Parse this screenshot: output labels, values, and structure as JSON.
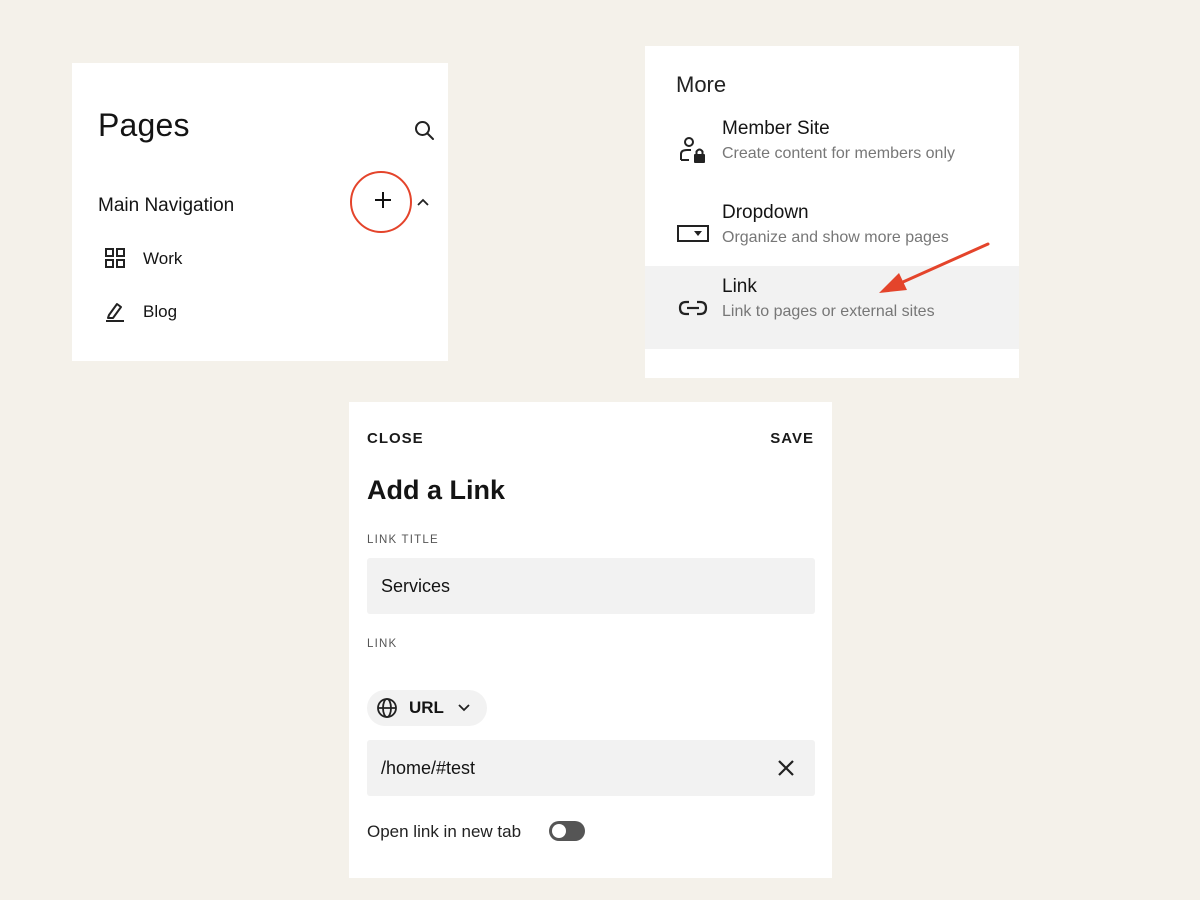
{
  "pages_panel": {
    "title": "Pages",
    "section_label": "Main Navigation",
    "items": [
      {
        "label": "Work",
        "icon": "grid-icon"
      },
      {
        "label": "Blog",
        "icon": "blog-edit-icon"
      }
    ]
  },
  "more_panel": {
    "title": "More",
    "items": [
      {
        "title": "Member Site",
        "desc": "Create content for members only",
        "icon": "member-lock-icon"
      },
      {
        "title": "Dropdown",
        "desc": "Organize and show more pages",
        "icon": "dropdown-icon"
      },
      {
        "title": "Link",
        "desc": "Link to pages or external sites",
        "icon": "link-icon"
      }
    ],
    "selected_index": 2
  },
  "link_panel": {
    "close_label": "CLOSE",
    "save_label": "SAVE",
    "title": "Add a Link",
    "link_title_label": "LINK TITLE",
    "link_title_value": "Services",
    "link_label": "LINK",
    "link_type": "URL",
    "url_value": "/home/#test",
    "new_tab_label": "Open link in new tab",
    "new_tab_enabled": false
  },
  "colors": {
    "background": "#f4f1ea",
    "highlight": "#e4442b",
    "field": "#f2f2f2"
  }
}
